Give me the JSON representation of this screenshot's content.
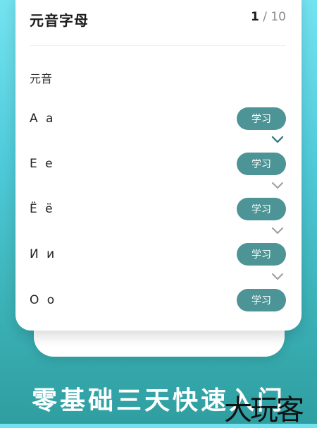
{
  "header": {
    "title": "元音字母",
    "progress_current": "1",
    "progress_total": "/ 10"
  },
  "section": {
    "label": "元音"
  },
  "letters": [
    {
      "letter": "А а",
      "button": "学习",
      "chevron_color": "#3d7f86"
    },
    {
      "letter": "Е е",
      "button": "学习",
      "chevron_color": "#9e9e9e"
    },
    {
      "letter": "Ё ё",
      "button": "学习",
      "chevron_color": "#9e9e9e"
    },
    {
      "letter": "И и",
      "button": "学习",
      "chevron_color": "#9e9e9e"
    },
    {
      "letter": "О о",
      "button": "学习"
    }
  ],
  "promo": {
    "slogan": "零基础三天快速入门",
    "watermark": "大玩客"
  },
  "colors": {
    "accent": "#4d9496",
    "background_top": "#74e3f0",
    "background_bottom": "#2f9ea1"
  }
}
